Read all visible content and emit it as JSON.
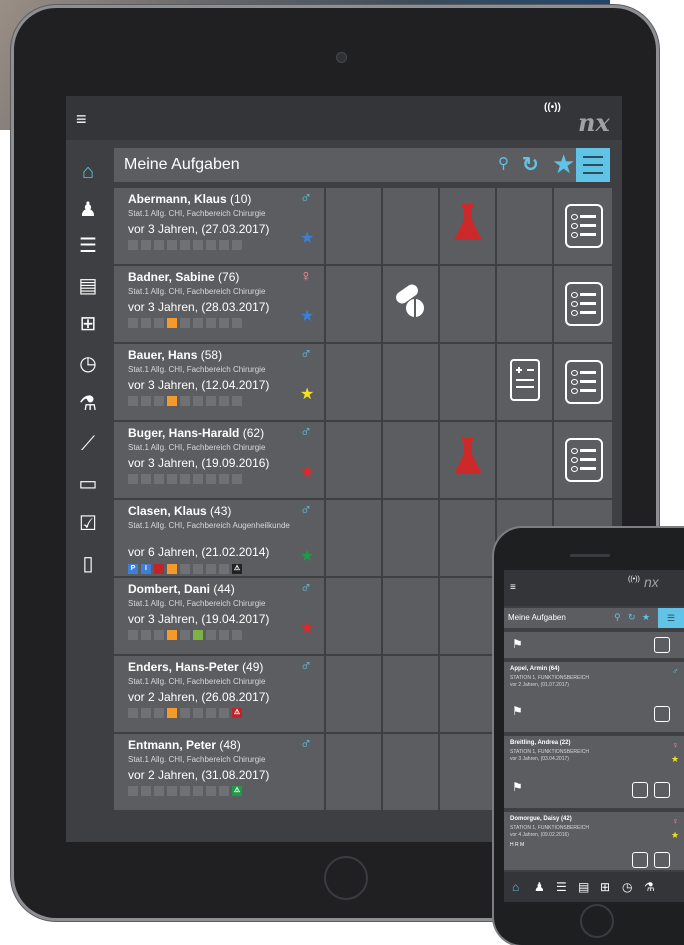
{
  "app": {
    "title": "Meine Aufgaben",
    "logo": "nx",
    "signal_icon": "((•))"
  },
  "colors": {
    "accent": "#61c3e6",
    "male": "#61c3e6",
    "female": "#ff8da0",
    "orange": "#f39a2b",
    "lab_red": "#cc2a2a"
  },
  "sidebar": {
    "items": [
      "home-icon",
      "patient-icon",
      "patient-list-icon",
      "clipboard-icon",
      "vitals-icon",
      "clock-icon",
      "lab-icon",
      "chart-icon",
      "bed-icon",
      "checkbox-icon",
      "document-icon"
    ]
  },
  "patients": [
    {
      "name": "Abermann, Klaus",
      "age": "(10)",
      "dept": "Stat.1 Allg. CHI, Fachbereich Chirurgie",
      "date": "vor 3 Jahren, (27.03.2017)",
      "gender": "♂",
      "star": "blue"
    },
    {
      "name": "Badner, Sabine",
      "age": "(76)",
      "dept": "Stat.1 Allg. CHI, Fachbereich Chirurgie",
      "date": "vor 3 Jahren, (28.03.2017)",
      "gender": "♀",
      "star": "blue"
    },
    {
      "name": "Bauer, Hans",
      "age": "(58)",
      "dept": "Stat.1 Allg. CHI, Fachbereich Chirurgie",
      "date": "vor 3 Jahren, (12.04.2017)",
      "gender": "♂",
      "star": "yellow"
    },
    {
      "name": "Buger, Hans-Harald",
      "age": "(62)",
      "dept": "Stat.1 Allg. CHI, Fachbereich Chirurgie",
      "date": "vor 3 Jahren, (19.09.2016)",
      "gender": "♂",
      "star": "red"
    },
    {
      "name": "Clasen, Klaus",
      "age": "(43)",
      "dept": "Stat.1 Allg. CHI, Fachbereich Augenheilkunde",
      "date": "vor 6 Jahren, (21.02.2014)",
      "gender": "♂",
      "star": "green"
    },
    {
      "name": "Dombert, Dani",
      "age": "(44)",
      "dept": "Stat.1 Allg. CHI, Fachbereich Chirurgie",
      "date": "vor 3 Jahren, (19.04.2017)",
      "gender": "♂",
      "star": "red"
    },
    {
      "name": "Enders, Hans-Peter",
      "age": "(49)",
      "dept": "Stat.1 Allg. CHI, Fachbereich Chirurgie",
      "date": "vor 2 Jahren, (26.08.2017)",
      "gender": "♂",
      "star": ""
    },
    {
      "name": "Entmann, Peter",
      "age": "(48)",
      "dept": "Stat.1 Allg. CHI, Fachbereich Chirurgie",
      "date": "vor 2 Jahren, (31.08.2017)",
      "gender": "♂",
      "star": ""
    }
  ],
  "badges": {
    "p": "P",
    "i": "I"
  },
  "phone": {
    "title": "Meine Aufgaben",
    "logo": "nx",
    "patients": [
      {
        "name": "Appel, Armin",
        "age": "(64)",
        "line1": "STATION 1, FUNKTIONSBEREICH",
        "line2": "vor 2 Jahren, (01.07.2017)"
      },
      {
        "name": "Breitling, Andrea",
        "age": "(22)",
        "line1": "STATION 1, FUNKTIONSBEREICH",
        "line2": "vor 3 Jahren, (03.04.2017)"
      },
      {
        "name": "Domorgue, Daisy",
        "age": "(42)",
        "line1": "STATION 1, FUNKTIONSBEREICH",
        "line2": "vor 4 Jahren, (09.02.2016)"
      }
    ],
    "badges": [
      "H",
      "R",
      "M"
    ]
  }
}
